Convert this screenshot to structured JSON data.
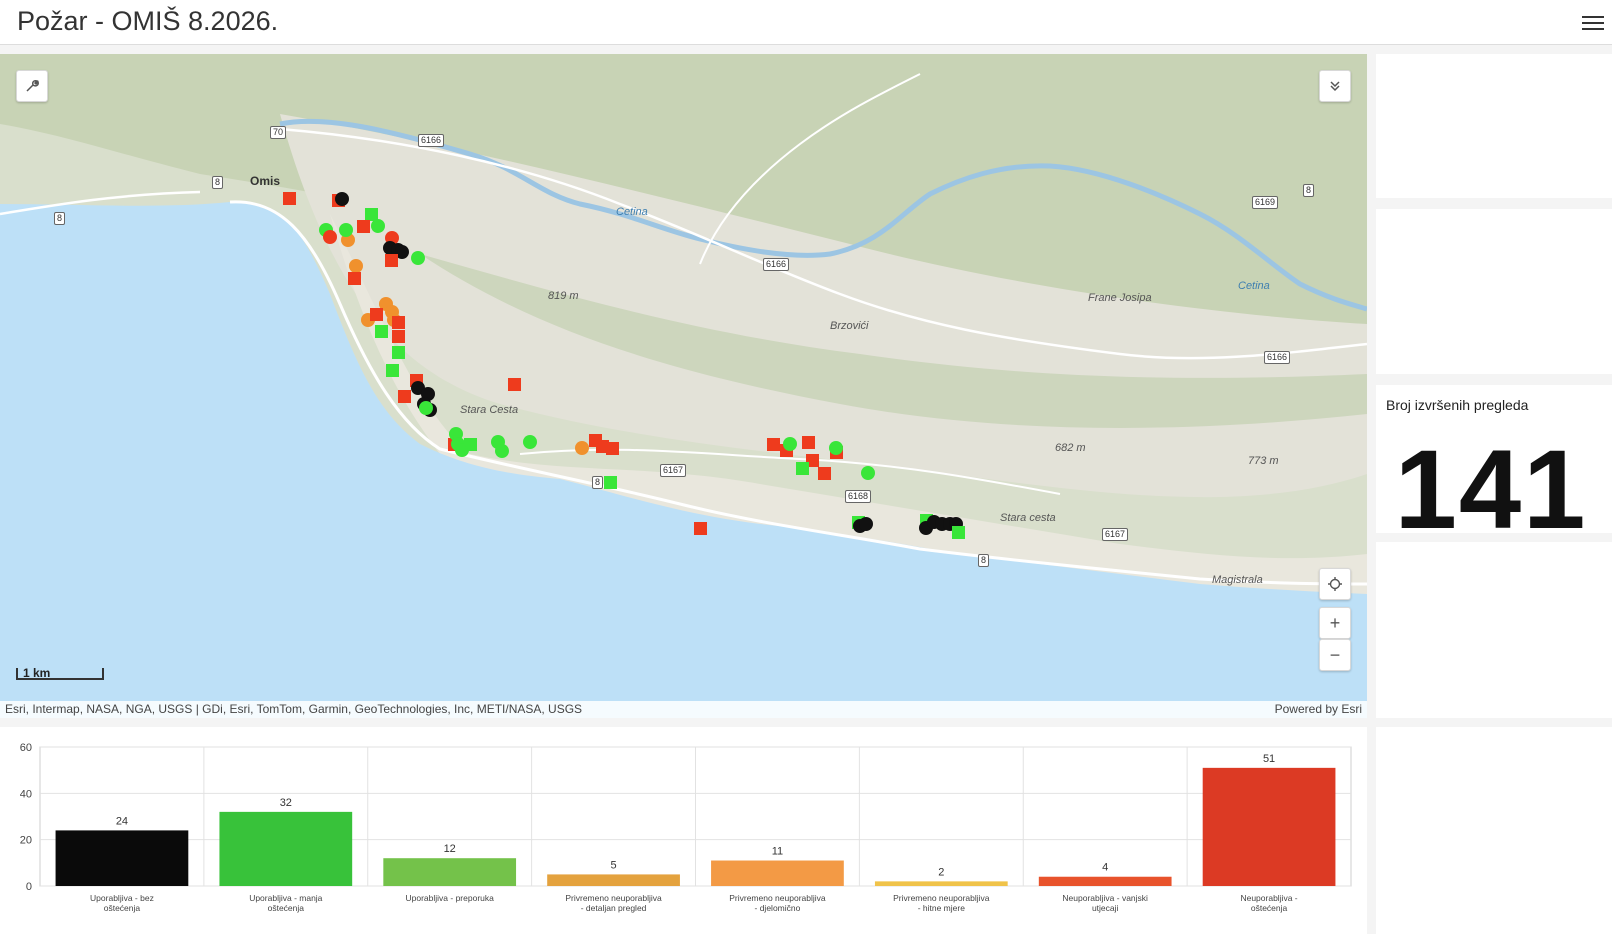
{
  "header": {
    "title": "Požar - OMIŠ 8.2026."
  },
  "map": {
    "attribution": "Esri, Intermap, NASA, NGA, USGS | GDi, Esri, TomTom, Garmin, GeoTechnologies, Inc, METI/NASA, USGS",
    "powered_by": "Powered by Esri",
    "scale_label": "1 km",
    "places": {
      "omis": "Omis",
      "cetina1": "Cetina",
      "cetina2": "Cetina",
      "stara1": "Stara Cesta",
      "stara2": "Stara cesta",
      "brzovici": "Brzovići",
      "frane": "Frane Josipa",
      "magistrala": "Magistrala",
      "elev1": "819 m",
      "elev2": "682 m",
      "elev3": "773 m"
    },
    "roads": {
      "r70": "70",
      "r8a": "8",
      "r8b": "8",
      "r6166a": "6166",
      "r6166b": "6166",
      "r6166c": "6166",
      "r6169": "6169",
      "r8c": "8",
      "r6167a": "6167",
      "r6168": "6168",
      "r8d": "8",
      "r6167b": "6167",
      "r8e": "8"
    },
    "tools": {
      "wrench": "wrench-icon",
      "collapse": "chevron-double-down-icon",
      "locate": "locate-icon",
      "zoom_in": "+",
      "zoom_out": "−"
    },
    "legend_colors": {
      "black": "#111111",
      "green": "#39e639",
      "orange": "#f0912d",
      "red": "#ee3b1d"
    }
  },
  "summary": {
    "title": "Broj izvršenih pregleda",
    "value": "141"
  },
  "chart_data": {
    "type": "bar",
    "categories": [
      "Uporabljiva - bez oštećenja",
      "Uporabljiva - manja oštećenja",
      "Uporabljiva - preporuka",
      "Privremeno neuporabljiva - detaljan pregled",
      "Privremeno neuporabljiva - djelomično",
      "Privremeno neuporabljiva - hitne mjere",
      "Neuporabljiva - vanjski utjecaji",
      "Neuporabljiva - oštećenja"
    ],
    "values": [
      24,
      32,
      12,
      5,
      11,
      2,
      4,
      51
    ],
    "colors": [
      "#0a0a0a",
      "#38c23a",
      "#74c24a",
      "#e4a23e",
      "#f39a45",
      "#f0c34a",
      "#e8532c",
      "#dc3a24"
    ],
    "ylim": [
      0,
      60
    ],
    "yticks": [
      "0",
      "20",
      "40",
      "60"
    ],
    "grid": true
  }
}
